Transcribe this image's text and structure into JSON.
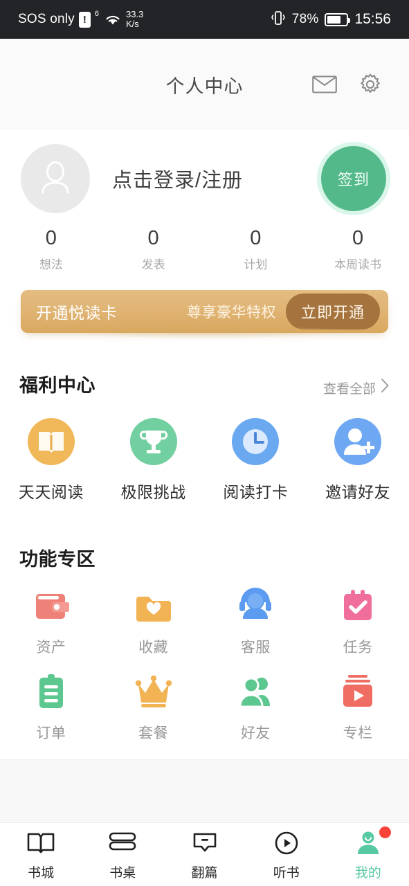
{
  "status_bar": {
    "carrier": "SOS only",
    "warning_icon": "!",
    "network_gen": "6",
    "wifi_icon": "wifi-icon",
    "speed_value": "33.3",
    "speed_unit": "K/s",
    "vibrate_icon": "vibrate-icon",
    "battery_percent": "78%",
    "battery_icon": "battery-icon",
    "time": "15:56"
  },
  "header": {
    "title": "个人中心",
    "mail_icon": "mail-icon",
    "settings_icon": "gear-icon"
  },
  "profile": {
    "avatar_icon": "avatar-placeholder-icon",
    "login_label": "点击登录/注册",
    "signin_label": "签到",
    "stats": [
      {
        "value": "0",
        "label": "想法"
      },
      {
        "value": "0",
        "label": "发表"
      },
      {
        "value": "0",
        "label": "计划"
      },
      {
        "value": "0",
        "label": "本周读书"
      }
    ]
  },
  "vip_banner": {
    "title": "开通悦读卡",
    "subtitle": "尊享豪华特权",
    "button_label": "立即开通"
  },
  "welfare": {
    "title": "福利中心",
    "more_label": "查看全部",
    "more_chevron": "chevron-right-icon",
    "items": [
      {
        "label": "天天阅读",
        "icon": "open-book-icon",
        "color": "#f0b858"
      },
      {
        "label": "极限挑战",
        "icon": "trophy-icon",
        "color": "#71cfa0"
      },
      {
        "label": "阅读打卡",
        "icon": "clock-icon",
        "color": "#6aa9ef"
      },
      {
        "label": "邀请好友",
        "icon": "add-friend-icon",
        "color": "#6fa8f2"
      }
    ]
  },
  "functions": {
    "title": "功能专区",
    "items": [
      {
        "label": "资产",
        "icon": "wallet-icon",
        "color": "#ee8278"
      },
      {
        "label": "收藏",
        "icon": "folder-heart-icon",
        "color": "#f2b355"
      },
      {
        "label": "客服",
        "icon": "headset-support-icon",
        "color": "#5b9bf0"
      },
      {
        "label": "任务",
        "icon": "calendar-check-icon",
        "color": "#f06e9c"
      },
      {
        "label": "订单",
        "icon": "clipboard-icon",
        "color": "#5cc78f"
      },
      {
        "label": "套餐",
        "icon": "crown-icon",
        "color": "#f2b355"
      },
      {
        "label": "好友",
        "icon": "friends-icon",
        "color": "#5cc78f"
      },
      {
        "label": "专栏",
        "icon": "video-column-icon",
        "color": "#ef6d62"
      }
    ]
  },
  "tabbar": {
    "active_color": "#57c9a3",
    "badge_color": "#f9423a",
    "items": [
      {
        "label": "书城",
        "icon": "open-book-outline-icon",
        "active": false,
        "badge": false
      },
      {
        "label": "书桌",
        "icon": "stacked-books-icon",
        "active": false,
        "badge": false
      },
      {
        "label": "翻篇",
        "icon": "speech-tag-icon",
        "active": false,
        "badge": false
      },
      {
        "label": "听书",
        "icon": "play-circle-icon",
        "active": false,
        "badge": false
      },
      {
        "label": "我的",
        "icon": "person-icon",
        "active": true,
        "badge": true
      }
    ]
  }
}
